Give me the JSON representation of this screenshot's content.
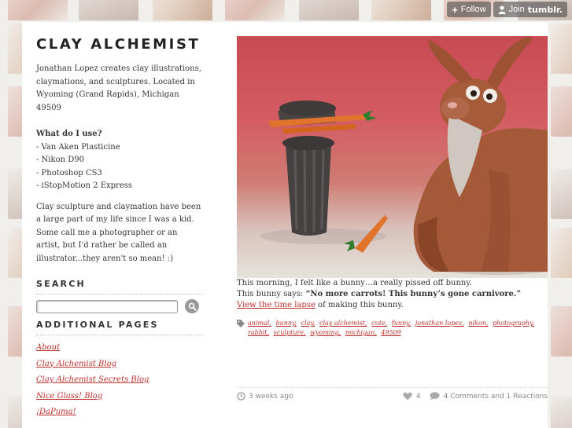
{
  "tumblr": {
    "follow_label": "Follow",
    "join_label": "Join",
    "brand": "tumblr."
  },
  "sidebar": {
    "title": "CLAY ALCHEMIST",
    "description": "Jonathan Lopez creates clay illustrations, claymations, and sculptures. Located in Wyoming (Grand Rapids), Michigan 49509",
    "uses_heading": "What do I use?",
    "uses": [
      "- Van Aken Plasticine",
      "- Nikon D90",
      "- Photoshop CS3",
      "- iStopMotion 2 Express"
    ],
    "about": "Clay sculpture and claymation have been a large part of my life since I was a kid. Some call me a photographer or an artist, but I'd rather be called an illustrator...they aren't so mean! :)",
    "search_heading": "SEARCH",
    "search_value": "",
    "pages_heading": "ADDITIONAL PAGES",
    "pages": [
      "About",
      "Clay Alchemist Blog",
      "Clay Alchemist Secrets Blog",
      "Nice Glass! Blog",
      "¡DaPuma!"
    ]
  },
  "post": {
    "text1": "This morning, I felt like a bunny…a really pissed off bunny.",
    "text2_prefix": "This bunny says: ",
    "text2_quote": "“No more carrots!  This bunny’s gone carnivore.”",
    "link_text": "View the time lapse",
    "link_suffix": " of making this bunny.",
    "tags": [
      "animal,",
      "bunny,",
      "clay,",
      "clay alchemist,",
      "cute,",
      "funny,",
      "jonathan lopez,",
      "nikon,",
      "photography,",
      "rabbit,",
      "sculpture,",
      "wyoming,",
      "michigan,",
      "49509"
    ],
    "time_ago": "3 weeks ago",
    "likes": "4",
    "comments": "4 Comments and 1 Reactions"
  },
  "colors": {
    "link": "#c0302c",
    "text": "#333333"
  }
}
